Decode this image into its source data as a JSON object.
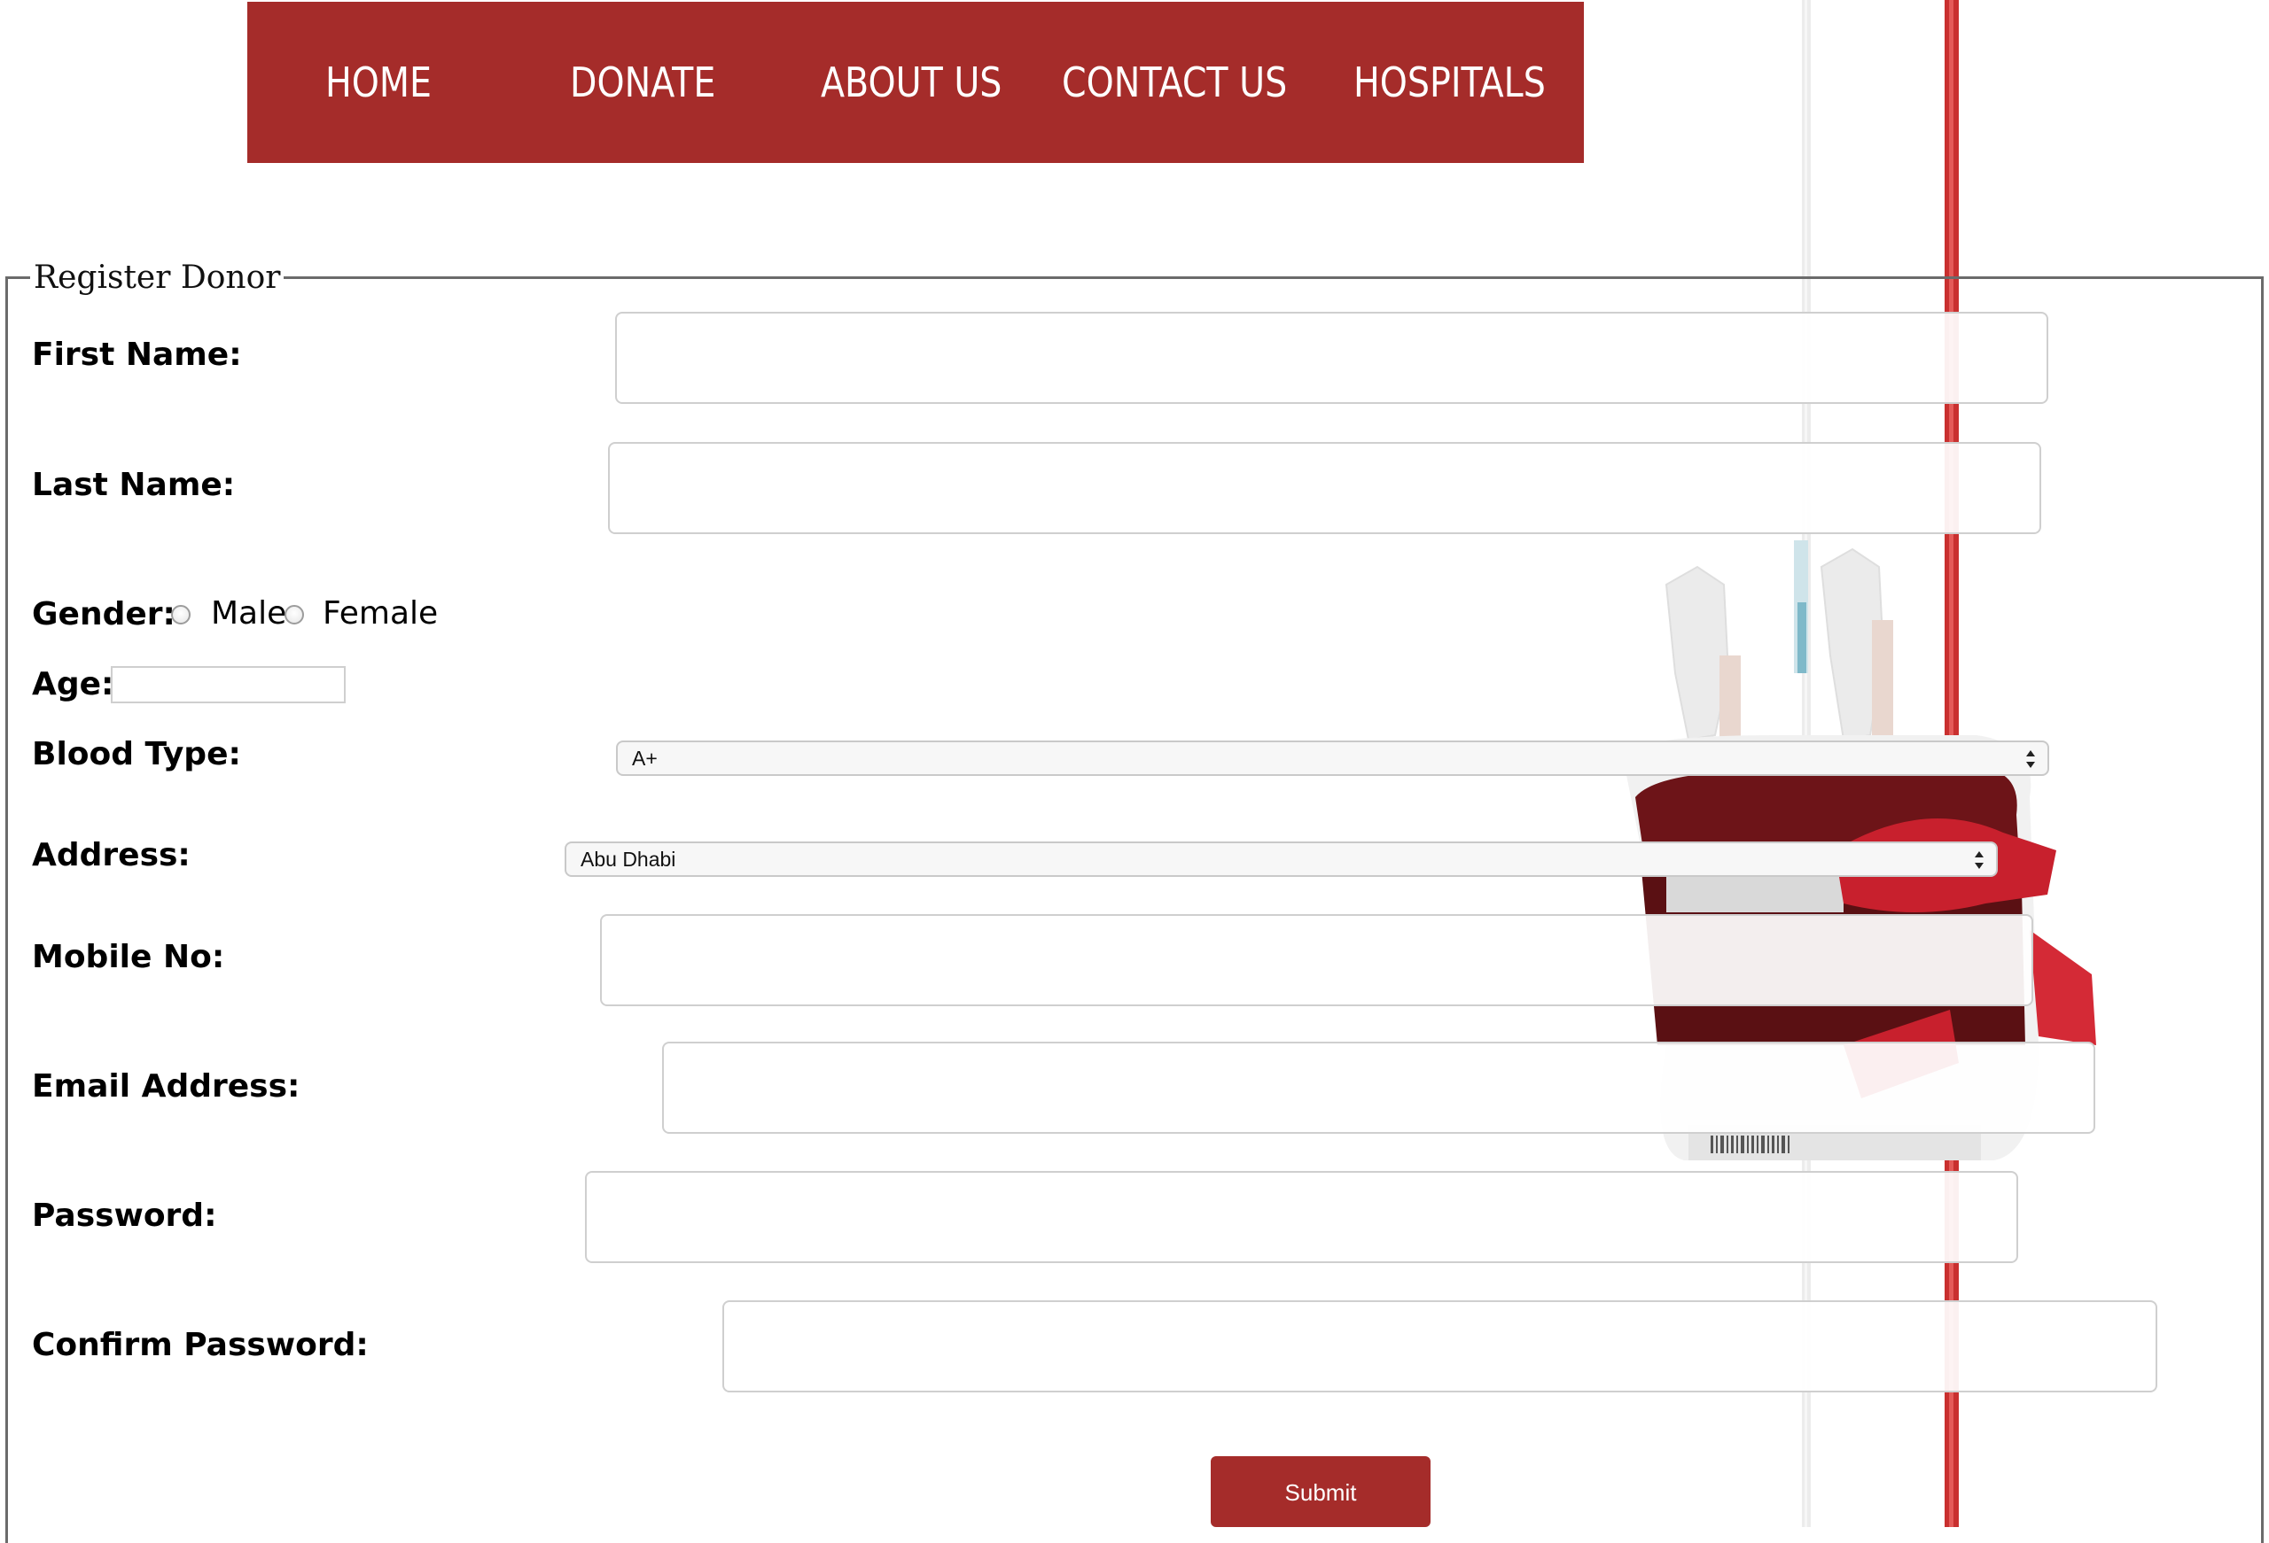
{
  "nav": {
    "items": [
      {
        "label": "HOME"
      },
      {
        "label": "DONATE"
      },
      {
        "label": "ABOUT US"
      },
      {
        "label": "CONTACT US"
      },
      {
        "label": "HOSPITALS"
      }
    ]
  },
  "form": {
    "legend": "Register Donor",
    "first_name": {
      "label": "First Name:",
      "value": ""
    },
    "last_name": {
      "label": "Last Name:",
      "value": ""
    },
    "gender": {
      "label": "Gender:",
      "options": [
        "Male",
        "Female"
      ],
      "selected": null
    },
    "age": {
      "label": "Age:",
      "value": ""
    },
    "blood_type": {
      "label": "Blood Type:",
      "selected": "A+"
    },
    "address": {
      "label": "Address:",
      "selected": "Abu Dhabi"
    },
    "mobile": {
      "label": "Mobile No:",
      "value": ""
    },
    "email": {
      "label": "Email Address:",
      "value": ""
    },
    "password": {
      "label": "Password:",
      "value": ""
    },
    "confirm_password": {
      "label": "Confirm Password:",
      "value": ""
    },
    "submit_label": "Submit"
  },
  "colors": {
    "brand": "#a52c2a",
    "page_background": "#ffffff"
  },
  "background_image": "iv-tubes-and-blood-bag-illustration"
}
